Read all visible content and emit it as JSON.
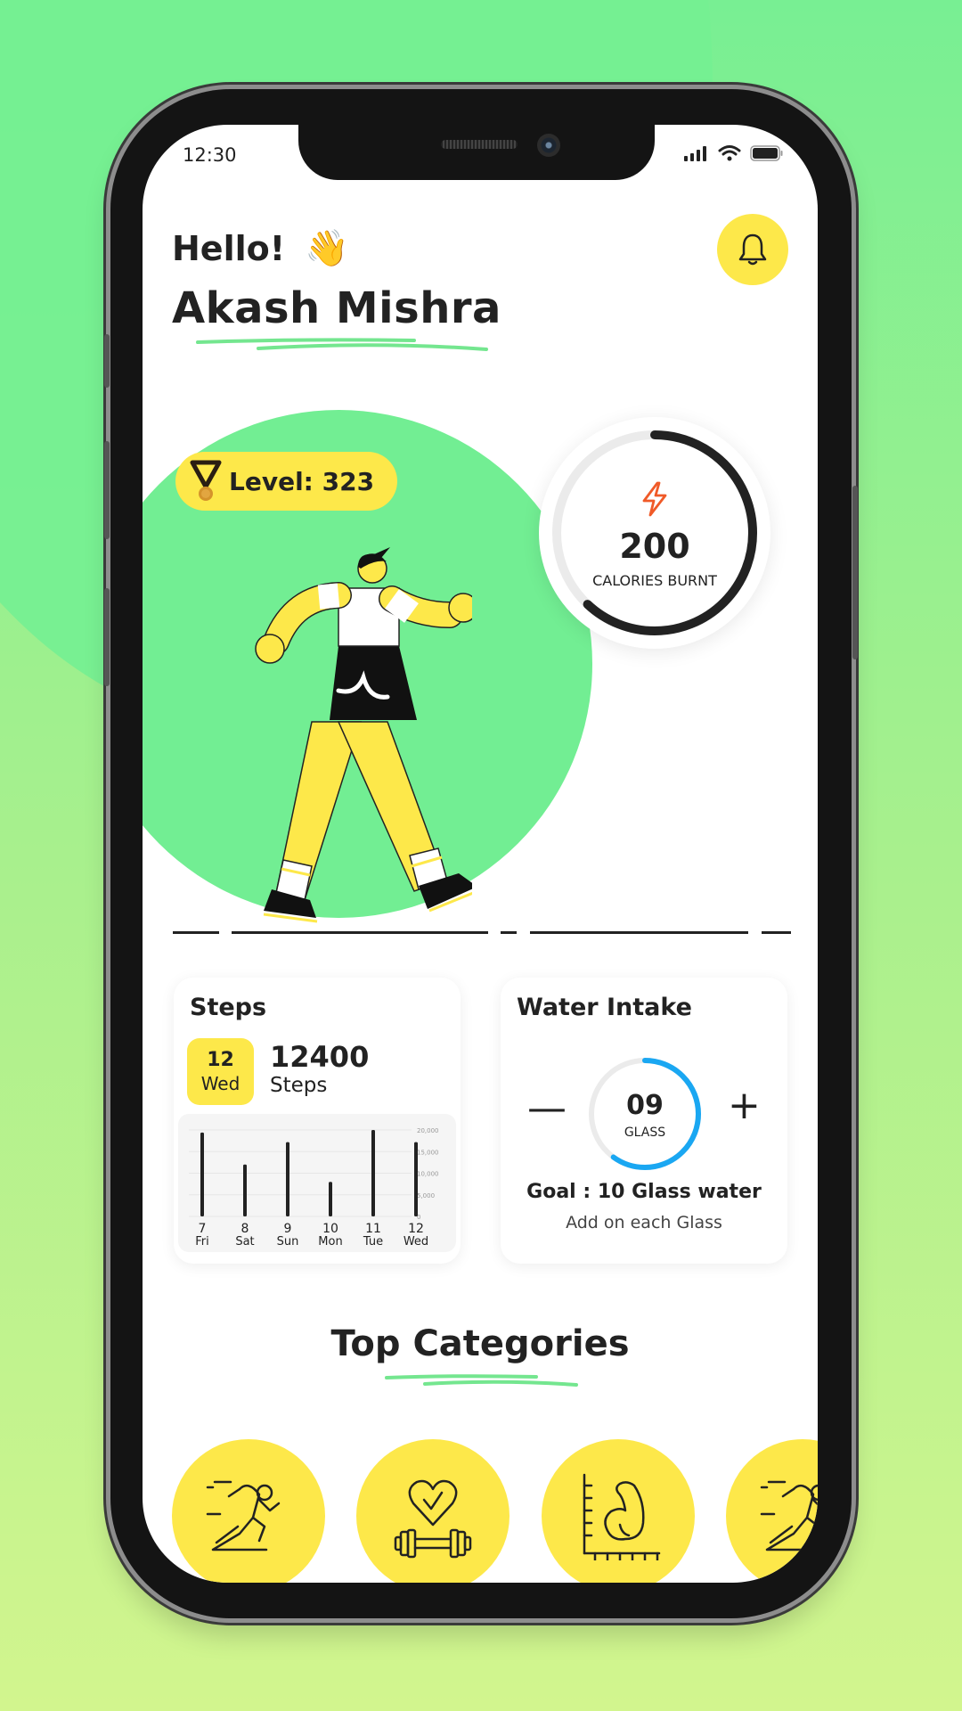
{
  "status_bar": {
    "time": "12:30",
    "icons": [
      "signal-icon",
      "wifi-icon",
      "battery-icon"
    ]
  },
  "header": {
    "greeting": "Hello!",
    "wave_emoji": "👋",
    "user_name": "Akash Mishra",
    "notification_icon": "bell-icon"
  },
  "hero": {
    "level_label": "Level: 323",
    "level_icon": "medal-icon",
    "calories": {
      "value": "200",
      "label": "CALORIES BURNT",
      "icon": "lightning-icon",
      "progress_fraction": 0.62
    }
  },
  "steps_card": {
    "title": "Steps",
    "date_day": "12",
    "date_weekday": "Wed",
    "count": "12400",
    "count_unit": "Steps"
  },
  "water_card": {
    "title": "Water Intake",
    "glasses": "09",
    "glasses_label": "GLASS",
    "progress_fraction": 0.6,
    "minus_label": "—",
    "plus_label": "+",
    "goal_text": "Goal : 10 Glass water",
    "hint_text": "Add on each Glass"
  },
  "categories": {
    "title": "Top Categories",
    "items": [
      {
        "icon": "running-icon"
      },
      {
        "icon": "heart-dumbbell-icon"
      },
      {
        "icon": "muscle-growth-icon"
      },
      {
        "icon": "running-icon"
      }
    ]
  },
  "colors": {
    "accent_yellow": "#fde84a",
    "accent_green": "#72ee93",
    "water_blue": "#1aa7f2",
    "lightning_orange": "#f05a28",
    "text_dark": "#222222"
  },
  "chart_data": {
    "type": "bar",
    "title": "",
    "xlabel": "",
    "ylabel": "",
    "categories": [
      "7 Fri",
      "8 Sat",
      "9 Sun",
      "10 Mon",
      "11 Tue",
      "12 Wed"
    ],
    "x_days": [
      "7",
      "8",
      "9",
      "10",
      "11",
      "12"
    ],
    "x_weekdays": [
      "Fri",
      "Sat",
      "Sun",
      "Mon",
      "Tue",
      "Wed"
    ],
    "values": [
      19400,
      12000,
      17200,
      8000,
      20000,
      17200
    ],
    "ylim": [
      0,
      20000
    ],
    "yticks": [
      0,
      5000,
      10000,
      15000,
      20000
    ],
    "ytick_labels": [
      "0",
      "5,000",
      "10,000",
      "15,000",
      "20,000"
    ],
    "y_axis_side": "right",
    "grid": true
  }
}
